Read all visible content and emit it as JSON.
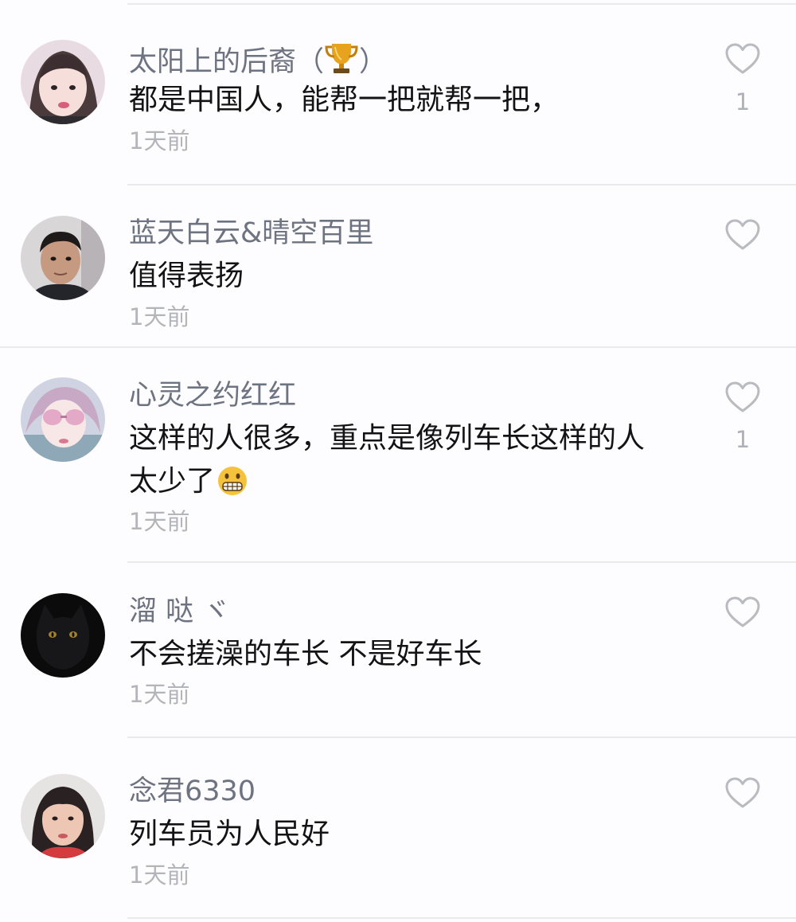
{
  "colors": {
    "background": "#fdfcfe",
    "username": "#6d7380",
    "text": "#131313",
    "time": "#b3b5bb",
    "like_icon": "#b9bbc1",
    "separator": "#ebe9ee"
  },
  "comments": [
    {
      "username": "太阳上的后裔（",
      "username_suffix": "）",
      "username_icon": "trophy-icon",
      "text": "都是中国人，能帮一把就帮一把，",
      "time": "1天前",
      "likes": "1",
      "avatar": "girl-portrait-avatar"
    },
    {
      "username": "蓝天白云&晴空百里",
      "text": "值得表扬",
      "time": "1天前",
      "likes": "",
      "avatar": "man-portrait-avatar"
    },
    {
      "username": "心灵之约红红",
      "text_line1": "这样的人很多，重点是像列车长这样的人",
      "text_line2": "太少了",
      "text_emoji": "grimacing-face-emoji",
      "time": "1天前",
      "likes": "1",
      "avatar": "sunglasses-portrait-avatar"
    },
    {
      "username": "溜 哒 ヾ",
      "text": "不会搓澡的车长 不是好车长",
      "time": "1天前",
      "likes": "",
      "avatar": "black-cat-avatar"
    },
    {
      "username": "念君6330",
      "text": "列车员为人民好",
      "time": "1天前",
      "likes": "",
      "avatar": "woman-portrait-avatar"
    }
  ]
}
